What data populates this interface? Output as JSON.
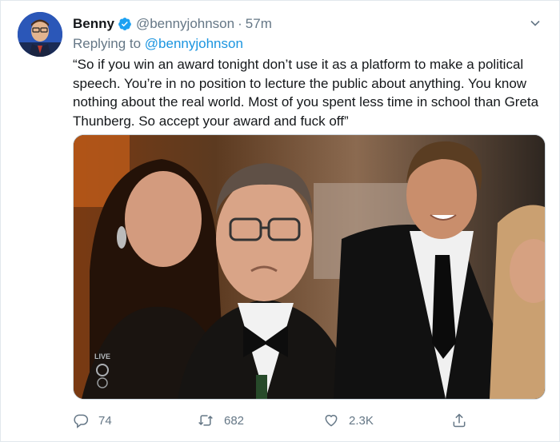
{
  "tweet": {
    "display_name": "Benny",
    "handle": "@bennyjohnson",
    "separator": "·",
    "time": "57m",
    "reply_prefix": "Replying to",
    "reply_to": "@bennyjohnson",
    "text": "“So if you win an award tonight don’t use it as a platform to make a political speech. You’re in no position to lecture the public about anything. You know nothing about the real world. Most of you spent less time in school than Greta Thunberg. So accept your award and fuck off”",
    "media": {
      "overlay_text": "LIVE"
    }
  },
  "actions": {
    "reply_count": "74",
    "retweet_count": "682",
    "like_count": "2.3K"
  },
  "colors": {
    "link": "#1b95e0",
    "verified": "#1da1f2",
    "muted": "#657786"
  },
  "icons": [
    "verified-badge-icon",
    "chevron-down-icon",
    "reply-icon",
    "retweet-icon",
    "like-icon",
    "share-icon"
  ]
}
